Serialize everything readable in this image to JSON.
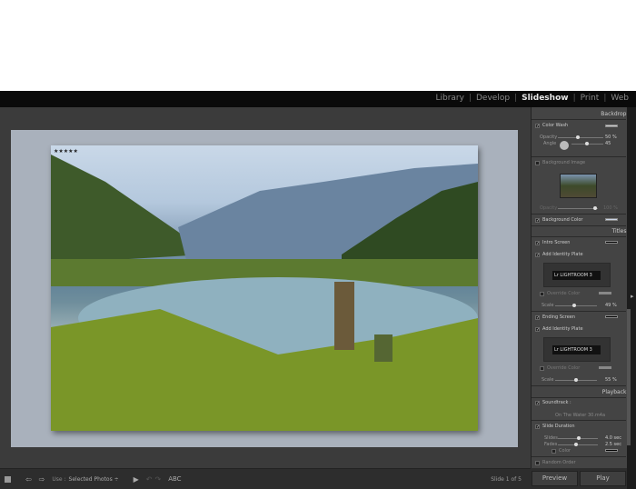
{
  "modules": [
    "Library",
    "Develop",
    "Slideshow",
    "Print",
    "Web"
  ],
  "active_module": "Slideshow",
  "photo": {
    "rating": "★★★★★",
    "rating_value": 5
  },
  "backdrop": {
    "title": "Backdrop ▼",
    "color_wash": "Color Wash",
    "opacity_label": "Opacity",
    "opacity": "50 %",
    "angle_label": "Angle",
    "angle": "45",
    "bg_image": "Background Image",
    "image_opacity_label": "Opacity",
    "image_opacity": "100 %",
    "bg_color": "Background Color"
  },
  "titles": {
    "title": "Titles ▼",
    "intro": "Intro Screen",
    "add_plate": "Add Identity Plate",
    "plate_text": "Lr LIGHTROOM 3",
    "override": "Override Color",
    "scale_label": "Scale",
    "intro_scale": "49 %",
    "ending": "Ending Screen",
    "add_plate2": "Add Identity Plate",
    "override2": "Override Color",
    "ending_scale": "55 %"
  },
  "playback": {
    "title": "Playback ▼",
    "soundtrack": "Soundtrack :",
    "track": "On The Water 30.m4a",
    "slide_duration": "Slide Duration",
    "slides_label": "Slides",
    "slides": "4.0 sec",
    "fades_label": "Fades",
    "fades": "2.5 sec",
    "color": "Color",
    "random": "Random Order"
  },
  "toolbar": {
    "use_label": "Use :",
    "use_value": "Selected Photos ÷",
    "abc": "ABC",
    "slide_count": "Slide 1 of 5"
  },
  "buttons": {
    "preview": "Preview",
    "play": "Play"
  }
}
